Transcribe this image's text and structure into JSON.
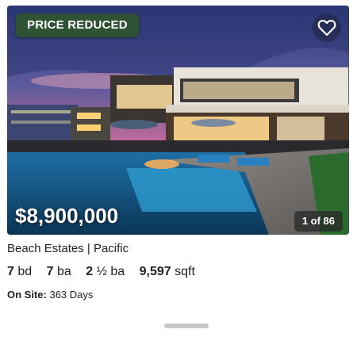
{
  "listing": {
    "badge": "PRICE REDUCED",
    "price": "$8,900,000",
    "photo_counter": "1 of 86",
    "title": "Beach Estates | Pacific",
    "beds_value": "7",
    "beds_unit": "bd",
    "baths_value": "7",
    "baths_unit": "ba",
    "half_baths_value": "2",
    "half_baths_unit": "½ ba",
    "sqft_value": "9,597",
    "sqft_unit": "sqft",
    "on_site_label": "On Site:",
    "on_site_value": "363 Days"
  },
  "icons": {
    "favorite": "heart-outline-icon",
    "drawer_handle": "drag-handle"
  },
  "colors": {
    "badge_bg": "#2f5134",
    "text": "#222222"
  }
}
